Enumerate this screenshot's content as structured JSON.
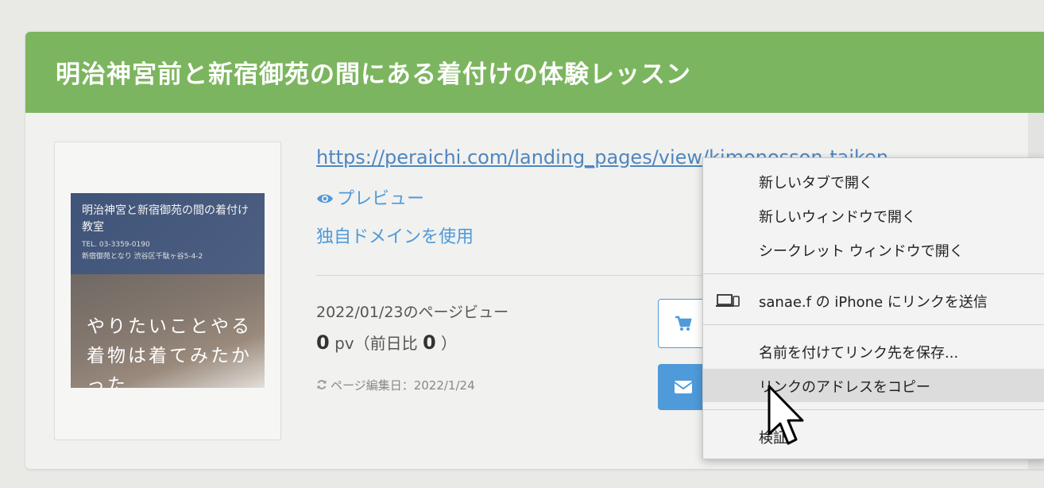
{
  "card": {
    "title": "明治神宮前と新宿御苑の間にある着付けの体験レッスン"
  },
  "thumbnail": {
    "title": "明治神宮と新宿御苑の間の着付け教室",
    "tel": "TEL. 03-3359-0190",
    "address": "新宿御苑となり 渋谷区千駄ヶ谷5-4-2",
    "catch": "やりたいことやる着物は着てみたかった"
  },
  "links": {
    "url": "https://peraichi.com/landing_pages/view/kimonosson-taiken",
    "preview": "プレビュー",
    "custom_domain": "独自ドメインを使用"
  },
  "stats": {
    "date_label": "2022/01/23のページビュー",
    "pv_value": "0",
    "pv_unit": "pv（前日比",
    "pv_diff": "0",
    "pv_close": "）",
    "edit_date": "ページ編集日：2022/1/24"
  },
  "icons": {
    "eye": "eye-icon",
    "refresh": "refresh-icon",
    "cart": "cart-icon",
    "mail": "mail-icon",
    "device": "device-icon",
    "cursor": "mouse-cursor-icon"
  },
  "context_menu": {
    "items": [
      {
        "label": "新しいタブで開く"
      },
      {
        "label": "新しいウィンドウで開く"
      },
      {
        "label": "シークレット ウィンドウで開く"
      },
      {
        "label": "sanae.f の iPhone にリンクを送信"
      },
      {
        "label": "名前を付けてリンク先を保存..."
      },
      {
        "label": "リンクのアドレスをコピー"
      },
      {
        "label": "検証"
      }
    ],
    "hovered_index": 5
  },
  "colors": {
    "header": "#7cb55f",
    "link": "#4f9ad9",
    "button": "#4f9ad9"
  }
}
